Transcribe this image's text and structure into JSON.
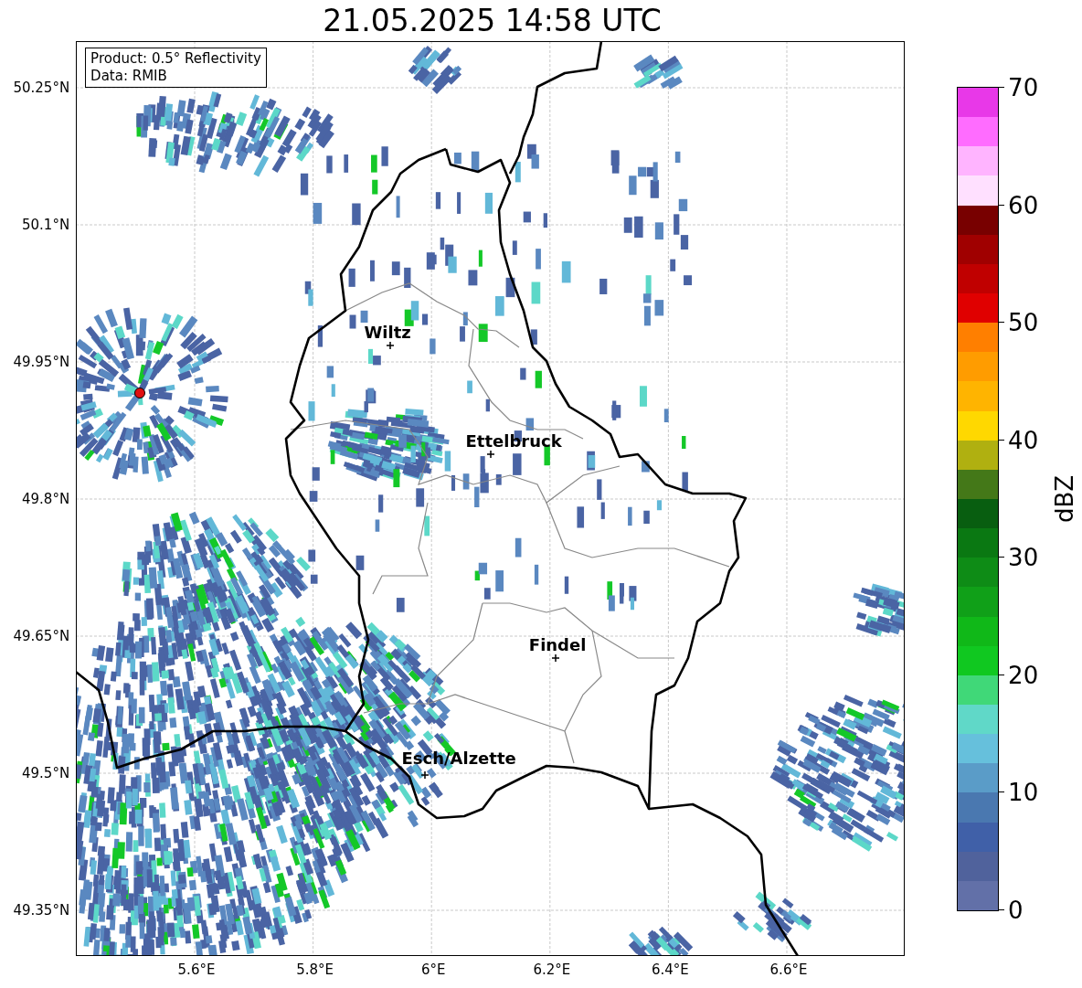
{
  "title": "21.05.2025 14:58 UTC",
  "info_box": {
    "lines": [
      "Product: 0.5° Reflectivity",
      "Data: RMIB"
    ]
  },
  "map": {
    "kind": "map",
    "lat_ticks": [
      "50.25°N",
      "50.1°N",
      "49.95°N",
      "49.8°N",
      "49.65°N",
      "49.5°N",
      "49.35°N"
    ],
    "lon_ticks": [
      "5.6°E",
      "5.8°E",
      "6°E",
      "6.2°E",
      "6.4°E",
      "6.6°E"
    ],
    "cities": [
      {
        "name": "Wiltz"
      },
      {
        "name": "Ettelbruck"
      },
      {
        "name": "Findel"
      },
      {
        "name": "Esch/Alzette"
      }
    ]
  },
  "colorbar": {
    "label": "dBZ",
    "ticks": [
      "70",
      "60",
      "50",
      "40",
      "30",
      "20",
      "10",
      "0"
    ],
    "bands": [
      {
        "color": "#6270a8"
      },
      {
        "color": "#50629c"
      },
      {
        "color": "#4060a8"
      },
      {
        "color": "#4a78b0"
      },
      {
        "color": "#5a9cc8"
      },
      {
        "color": "#66c0dc"
      },
      {
        "color": "#60d8c8"
      },
      {
        "color": "#40d878"
      },
      {
        "color": "#10c820"
      },
      {
        "color": "#10b818"
      },
      {
        "color": "#10a018"
      },
      {
        "color": "#0e8c16"
      },
      {
        "color": "#0a7812"
      },
      {
        "color": "#085e10"
      },
      {
        "color": "#447818"
      },
      {
        "color": "#b0b010"
      },
      {
        "color": "#ffd800"
      },
      {
        "color": "#ffb400"
      },
      {
        "color": "#ff9c00"
      },
      {
        "color": "#ff7f00"
      },
      {
        "color": "#e00000"
      },
      {
        "color": "#c00000"
      },
      {
        "color": "#a00000"
      },
      {
        "color": "#780000"
      },
      {
        "color": "#ffe0ff"
      },
      {
        "color": "#ffb4ff"
      },
      {
        "color": "#ff6cff"
      },
      {
        "color": "#e838e8"
      }
    ]
  }
}
